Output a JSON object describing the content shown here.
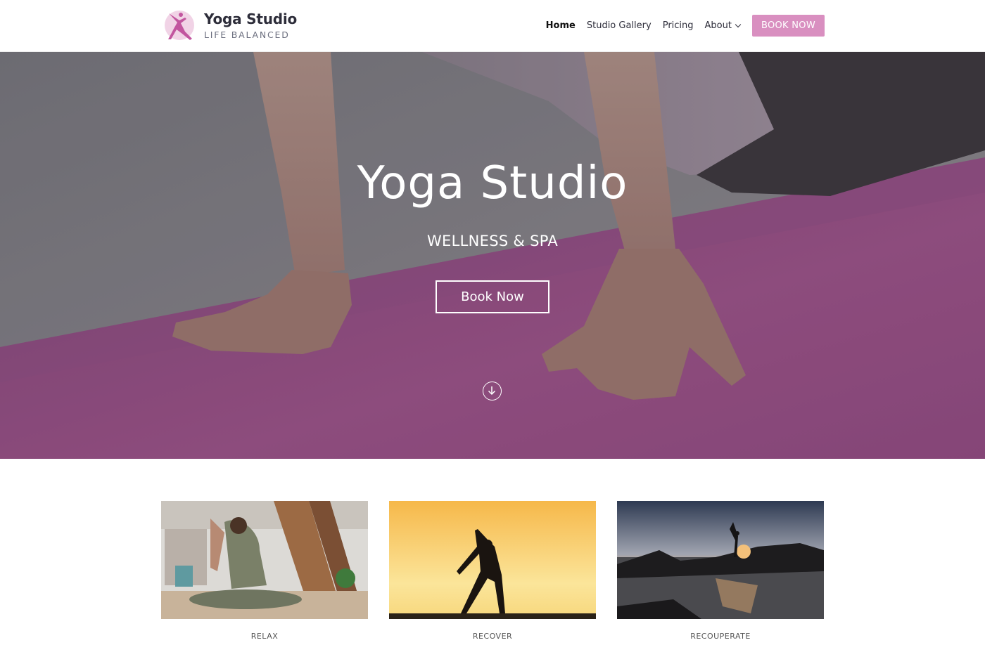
{
  "brand": {
    "title": "Yoga Studio",
    "tagline": "LIFE BALANCED",
    "accent_color": "#d98fc0",
    "logo_icon": "yoga-pose-icon"
  },
  "nav": {
    "items": [
      {
        "label": "Home",
        "active": true
      },
      {
        "label": "Studio Gallery",
        "active": false
      },
      {
        "label": "Pricing",
        "active": false
      },
      {
        "label": "About",
        "active": false,
        "has_dropdown": true
      }
    ],
    "cta_label": "BOOK NOW"
  },
  "hero": {
    "title": "Yoga Studio",
    "subtitle": "WELLNESS & SPA",
    "button_label": "Book Now",
    "scroll_icon": "arrow-down-circle-icon",
    "image_subject": "hands-on-pink-yoga-mat"
  },
  "features": [
    {
      "label": "RELAX",
      "image_subject": "woman-stretching-indoors"
    },
    {
      "label": "RECOVER",
      "image_subject": "silhouette-dancer-sunset"
    },
    {
      "label": "RECOUPERATE",
      "image_subject": "silhouette-pose-on-beach-rocks"
    }
  ]
}
